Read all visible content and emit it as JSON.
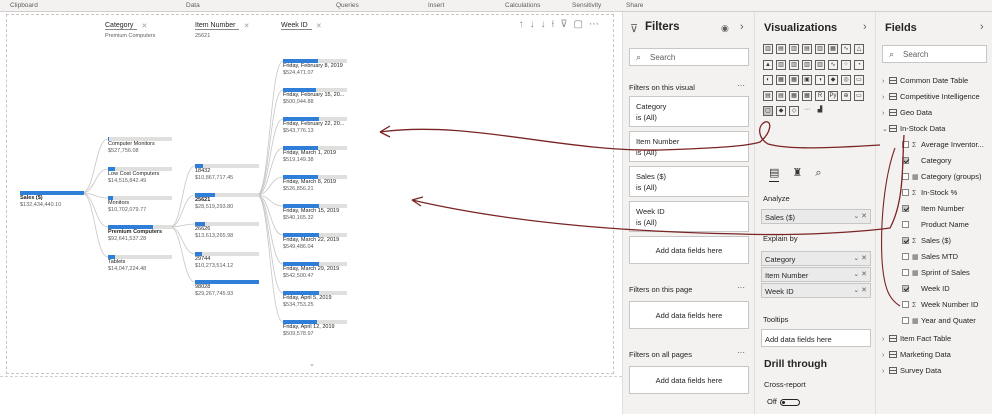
{
  "ribbon": {
    "groups": [
      "Clipboard",
      "Data",
      "Queries",
      "Insert",
      "Calculations",
      "Sensitivity",
      "Share"
    ]
  },
  "visual": {
    "columns": [
      {
        "title": "Category",
        "filter": "Premium Computers"
      },
      {
        "title": "Item Number",
        "filter": "25621"
      },
      {
        "title": "Week ID",
        "filter": ""
      }
    ],
    "root": {
      "name": "Sales ($)",
      "value": "$132,434,440.10",
      "fill": 1.0
    },
    "categories": [
      {
        "name": "Computer Monitors",
        "value": "$527,756.08",
        "fill": 0.01
      },
      {
        "name": "Low Cost Computers",
        "value": "$14,515,842.49",
        "fill": 0.11
      },
      {
        "name": "Monitors",
        "value": "$10,702,079.77",
        "fill": 0.08
      },
      {
        "name": "Premium Computers",
        "value": "$92,641,537.28",
        "fill": 0.7,
        "selected": true
      },
      {
        "name": "Tablets",
        "value": "$14,047,224.48",
        "fill": 0.11
      }
    ],
    "items": [
      {
        "name": "18432",
        "value": "$10,867,717.45",
        "fill": 0.12
      },
      {
        "name": "25621",
        "value": "$28,519,293.80",
        "fill": 0.31,
        "selected": true
      },
      {
        "name": "26626",
        "value": "$13,613,265.98",
        "fill": 0.15
      },
      {
        "name": "29744",
        "value": "$10,273,514.12",
        "fill": 0.11
      },
      {
        "name": "98028",
        "value": "$29,267,745.93",
        "fill": 1.0
      }
    ],
    "weeks": [
      {
        "name": "Friday, February 8, 2019",
        "value": "$524,471.07",
        "fill": 0.55
      },
      {
        "name": "Friday, February 15, 20...",
        "value": "$500,044.88",
        "fill": 0.52
      },
      {
        "name": "Friday, February 22, 20...",
        "value": "$543,776.13",
        "fill": 0.57
      },
      {
        "name": "Friday, March 1, 2019",
        "value": "$519,149.38",
        "fill": 0.54
      },
      {
        "name": "Friday, March 8, 2019",
        "value": "$526,856.21",
        "fill": 0.55
      },
      {
        "name": "Friday, March 15, 2019",
        "value": "$540,165.32",
        "fill": 0.56
      },
      {
        "name": "Friday, March 22, 2019",
        "value": "$549,486.04",
        "fill": 0.57
      },
      {
        "name": "Friday, March 29, 2019",
        "value": "$542,500.47",
        "fill": 0.57
      },
      {
        "name": "Friday, April 5, 2019",
        "value": "$534,753.25",
        "fill": 0.56
      },
      {
        "name": "Friday, April 12, 2019",
        "value": "$509,578.97",
        "fill": 0.53
      }
    ]
  },
  "filters": {
    "title": "Filters",
    "search_placeholder": "Search",
    "on_visual": "Filters on this visual",
    "cards": [
      {
        "field": "Category",
        "state": "is (All)"
      },
      {
        "field": "Item Number",
        "state": "is (All)"
      },
      {
        "field": "Sales ($)",
        "state": "is (All)"
      },
      {
        "field": "Week ID",
        "state": "is (All)"
      }
    ],
    "add_fields": "Add data fields here",
    "on_page": "Filters on this page",
    "on_all": "Filters on all pages"
  },
  "viz": {
    "title": "Visualizations",
    "analyze": "Analyze",
    "analyze_field": "Sales ($)",
    "explain_by": "Explain by",
    "explain_fields": [
      "Category",
      "Item Number",
      "Week ID"
    ],
    "tooltips": "Tooltips",
    "tooltips_add": "Add data fields here",
    "drill_through": "Drill through",
    "cross_report": "Cross-report",
    "toggle_label": "Off"
  },
  "fields": {
    "title": "Fields",
    "search_placeholder": "Search",
    "tables_top": [
      "Common Date Table",
      "Competitive Intelligence",
      "Geo Data"
    ],
    "open_table": "In-Stock Data",
    "columns": [
      {
        "name": "Average Inventor...",
        "type": "Σ",
        "checked": false
      },
      {
        "name": "Category",
        "type": "",
        "checked": true
      },
      {
        "name": "Category (groups)",
        "type": "grp",
        "checked": false
      },
      {
        "name": "In-Stock %",
        "type": "Σ",
        "checked": false
      },
      {
        "name": "Item Number",
        "type": "",
        "checked": true
      },
      {
        "name": "Product Name",
        "type": "",
        "checked": false
      },
      {
        "name": "Sales ($)",
        "type": "Σ",
        "checked": true
      },
      {
        "name": "Sales MTD",
        "type": "grp",
        "checked": false
      },
      {
        "name": "Sprint of Sales",
        "type": "grp",
        "checked": false
      },
      {
        "name": "Week ID",
        "type": "",
        "checked": true
      },
      {
        "name": "Week Number ID",
        "type": "Σ",
        "checked": false
      },
      {
        "name": "Year and Quater",
        "type": "grp",
        "checked": false
      }
    ],
    "tables_bottom": [
      "Item Fact Table",
      "Marketing Data",
      "Survey Data"
    ]
  }
}
